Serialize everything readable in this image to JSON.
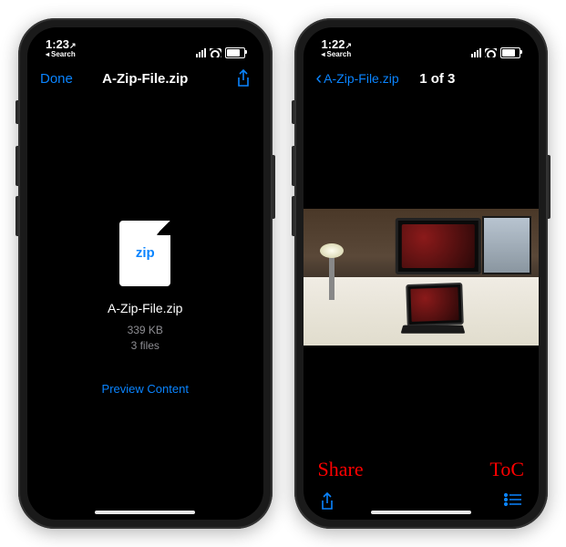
{
  "phone1": {
    "status": {
      "time": "1:23",
      "time_arrow": "↗",
      "back_label": "Search"
    },
    "nav": {
      "left": "Done",
      "title": "A-Zip-File.zip"
    },
    "file": {
      "icon_label": "zip",
      "name": "A-Zip-File.zip",
      "size": "339 KB",
      "count": "3 files",
      "preview_label": "Preview Content"
    }
  },
  "phone2": {
    "status": {
      "time": "1:22",
      "time_arrow": "↗",
      "back_label": "Search"
    },
    "nav": {
      "back": "A-Zip-File.zip",
      "title": "1 of 3"
    },
    "annotations": {
      "share": "Share",
      "toc": "ToC"
    }
  }
}
